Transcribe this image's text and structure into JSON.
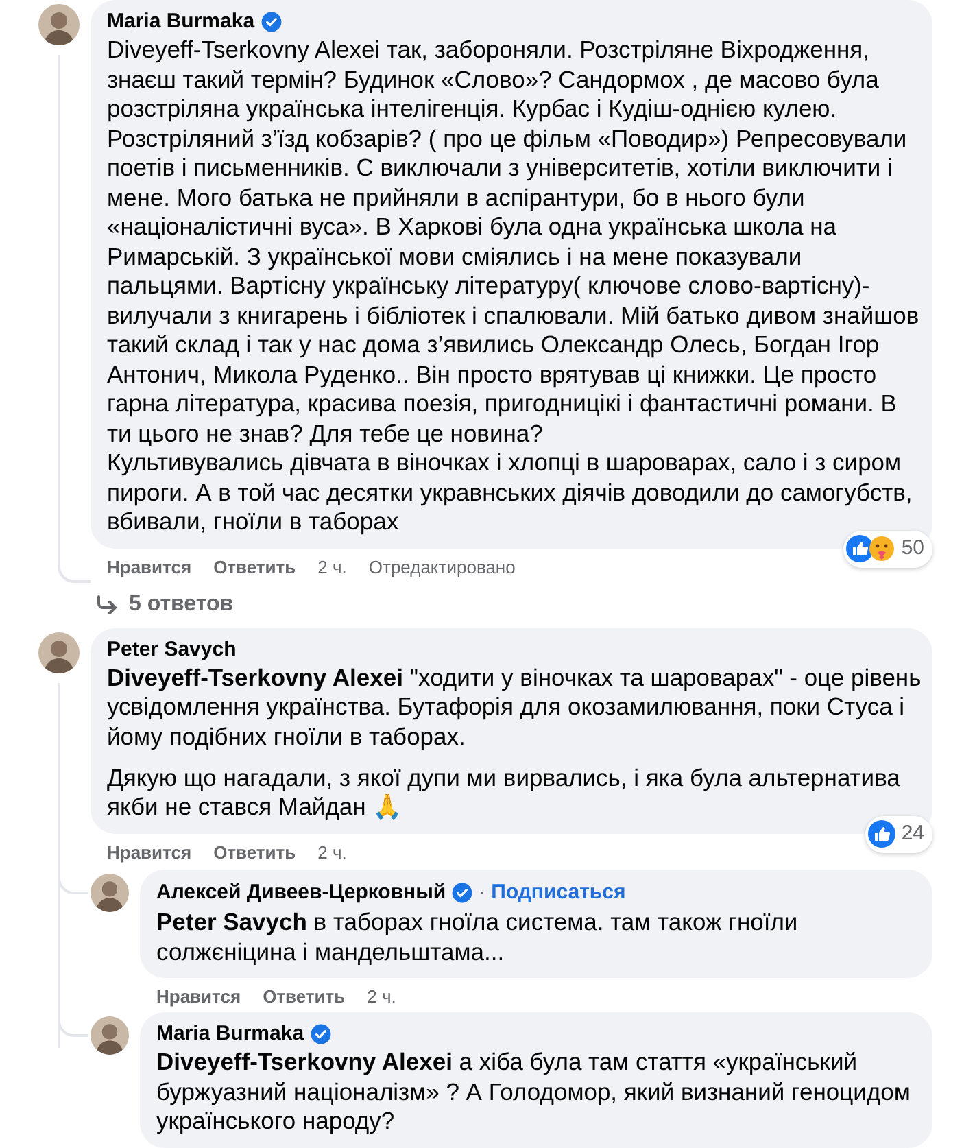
{
  "comments": [
    {
      "author": "Maria Burmaka",
      "verified": true,
      "text": "Diveyeff-Tserkovny Alexei так, забороняли. Розстріляне Віхродження, знаєш такий термін? Будинок «Слово»? Сандормох , де масово була розстріляна українська інтелігенція. Курбас і Кудіш-однією кулею. Розстріляний з’їзд кобзарів? ( про це фільм «Поводир») Репресовували поетів і письменників. С виключали з університетів, хотіли виключити і мене. Мого батька не прийняли в аспірантури, бо в нього були «націоналістичні вуса». В Харкові була одна українська школа на Римарській. З української мови сміялись і на мене показували пальцями. Вартісну українську літературу( ключове слово-вартісну)- вилучали з книгарень і бібліотек і спалювали. Мій батько дивом знайшов такий склад і так у нас дома з’явились Олександр Олесь, Богдан Ігор Антонич, Микола Руденко.. Він просто врятував ці книжки. Це просто гарна література, красива поезія, пригодницікі і фантастичні романи. В ти цього не знав? Для тебе це новина?\nКультивувались дівчата в віночках і хлопці в шароварах, сало і з сиром пироги. А в той час десятки укравнських діячів доводили до самогубств, вбивали, гноїли в таборах",
      "actions": [
        "Нравится",
        "Ответить"
      ],
      "time": "2 ч.",
      "edited_label": "Отредактировано",
      "reactions": {
        "icons": [
          {
            "kind": "like"
          },
          {
            "kind": "care"
          }
        ],
        "count": "50"
      },
      "replies_link": "5 ответов"
    },
    {
      "author": "Peter Savych",
      "verified": false,
      "paragraphs": [
        "**Diveyeff-Tserkovny Alexei** \"ходити у віночках та шароварах\" - оце рівень усвідомлення українства. Бутафорія для окозамилювання, поки Стуса і йому подібних гноїли в таборах.",
        "Дякую що нагадали, з якої дупи ми вирвались, і яка була альтернатива якби не стався Майдан 🙏"
      ],
      "actions": [
        "Нравится",
        "Ответить"
      ],
      "time": "2 ч.",
      "reactions": {
        "icons": [
          {
            "kind": "like"
          }
        ],
        "count": "24"
      },
      "children": [
        {
          "author": "Алексей Дивеев-Церковный",
          "verified": true,
          "separator": "·",
          "follow_label": "Подписаться",
          "text": "**Peter Savych** в таборах гноїла система. там також гноїли солжєніцина і мандельштама...",
          "actions": [
            "Нравится",
            "Ответить"
          ],
          "time": "2 ч."
        },
        {
          "author": "Maria Burmaka",
          "verified": true,
          "text": "**Diveyeff-Tserkovny Alexei** а хіба була там стаття «український буржуазний націоналізм» ? А Голодомор, який визнаний геноцидом українського народу?"
        }
      ]
    }
  ]
}
